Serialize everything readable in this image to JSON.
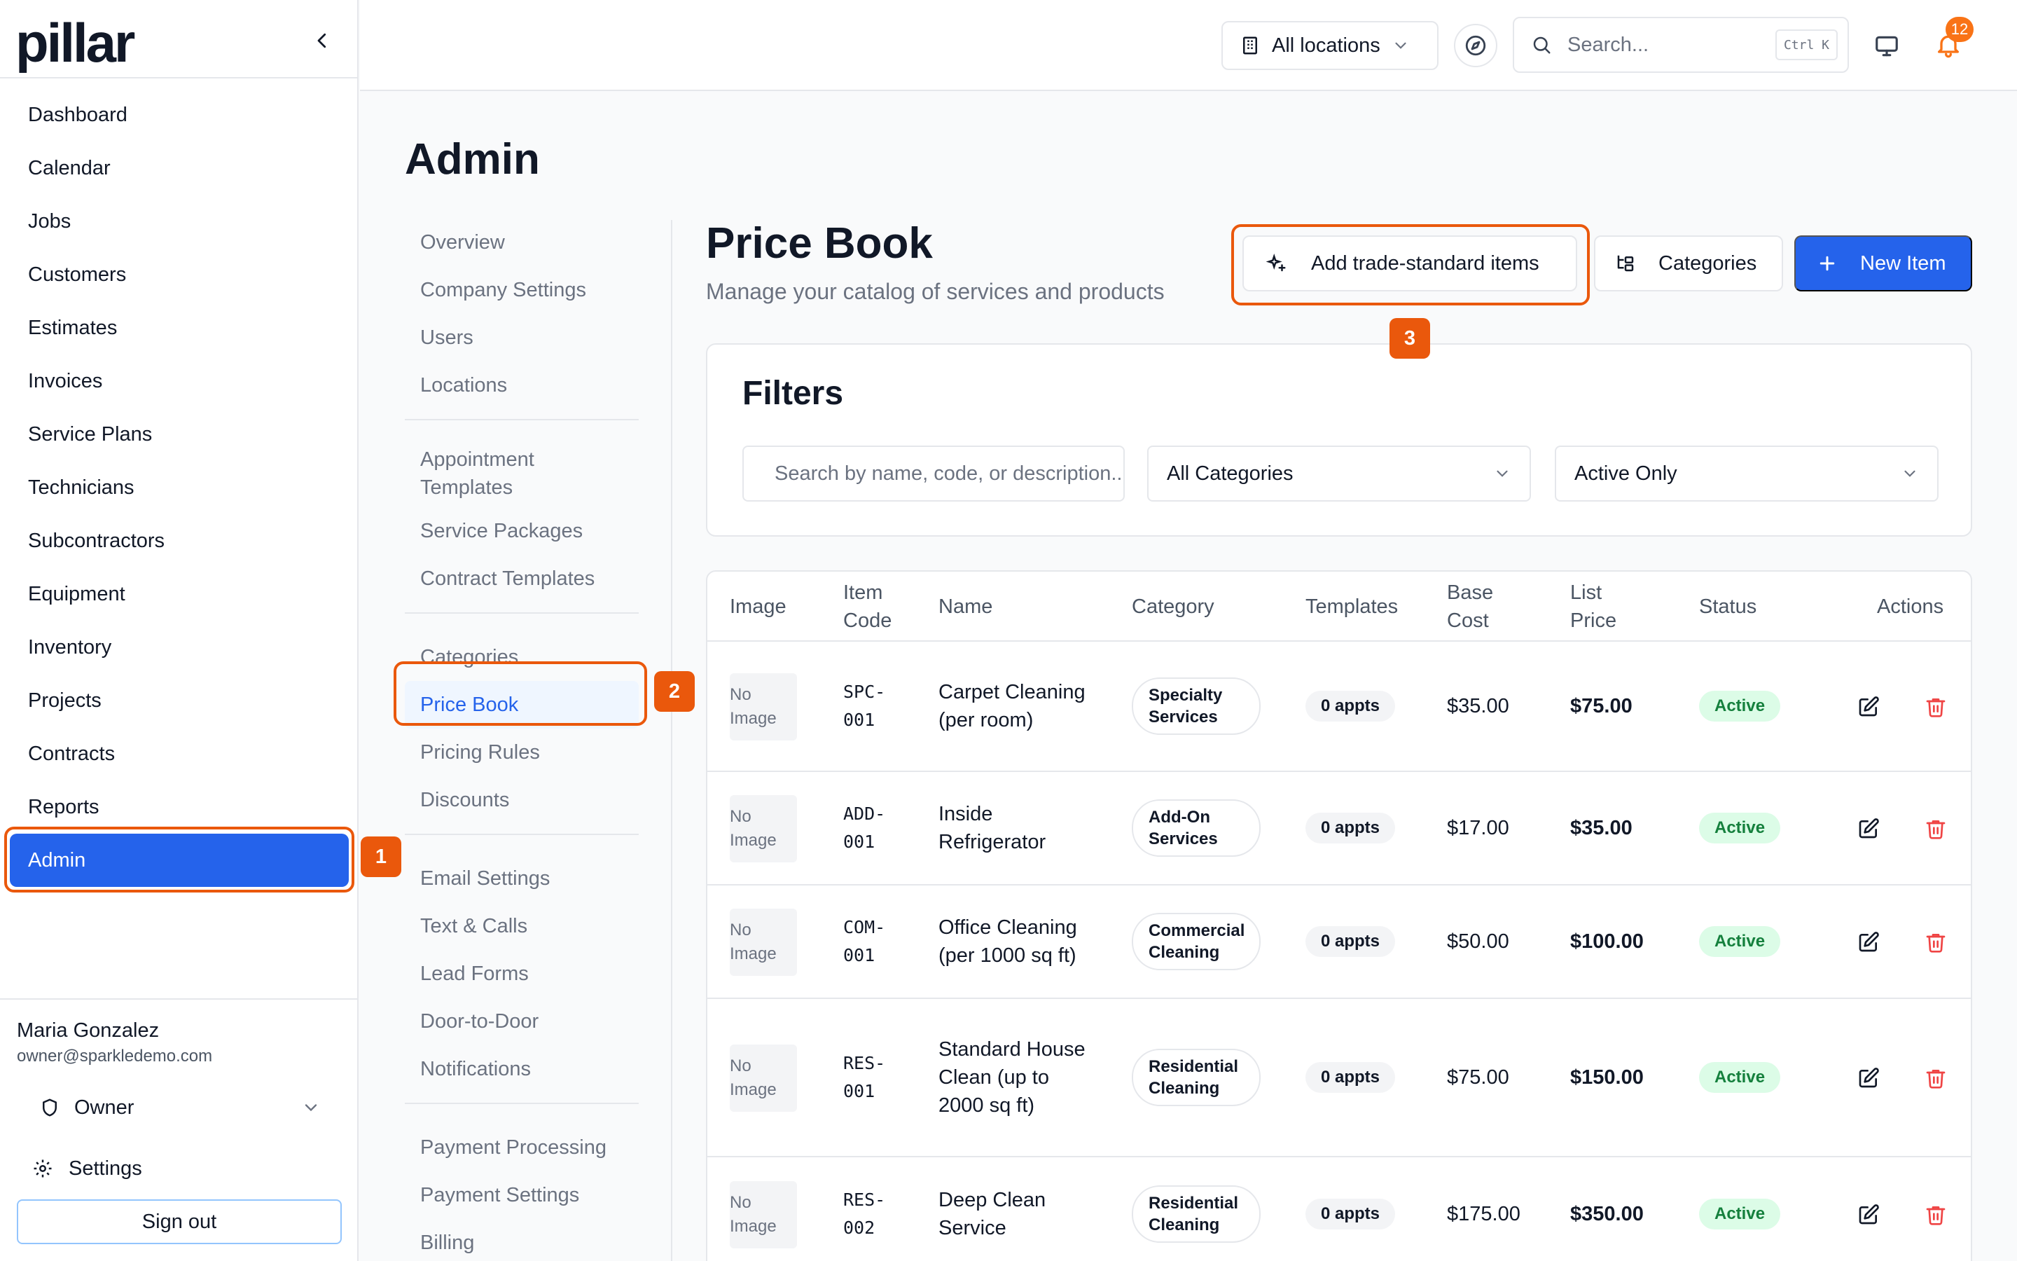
{
  "sidebar": {
    "logo": "pillar",
    "nav": [
      {
        "label": "Dashboard",
        "active": false
      },
      {
        "label": "Calendar",
        "active": false
      },
      {
        "label": "Jobs",
        "active": false
      },
      {
        "label": "Customers",
        "active": false
      },
      {
        "label": "Estimates",
        "active": false
      },
      {
        "label": "Invoices",
        "active": false
      },
      {
        "label": "Service Plans",
        "active": false
      },
      {
        "label": "Technicians",
        "active": false
      },
      {
        "label": "Subcontractors",
        "active": false
      },
      {
        "label": "Equipment",
        "active": false
      },
      {
        "label": "Inventory",
        "active": false
      },
      {
        "label": "Projects",
        "active": false
      },
      {
        "label": "Contracts",
        "active": false
      },
      {
        "label": "Reports",
        "active": false
      },
      {
        "label": "Admin",
        "active": true
      }
    ],
    "user": {
      "name": "Maria Gonzalez",
      "email": "owner@sparkledemo.com",
      "role": "Owner"
    },
    "settings_label": "Settings",
    "signout_label": "Sign out"
  },
  "topbar": {
    "location": "All locations",
    "search_placeholder": "Search...",
    "shortcut": "Ctrl K",
    "notification_count": "12"
  },
  "admin": {
    "title": "Admin",
    "subnav": [
      {
        "label": "Overview"
      },
      {
        "label": "Company Settings"
      },
      {
        "label": "Users"
      },
      {
        "label": "Locations"
      },
      {
        "sep": true
      },
      {
        "label": "Appointment Templates",
        "two_line": true
      },
      {
        "label": "Service Packages"
      },
      {
        "label": "Contract Templates"
      },
      {
        "sep": true
      },
      {
        "label": "Categories"
      },
      {
        "label": "Price Book",
        "active": true
      },
      {
        "label": "Pricing Rules"
      },
      {
        "label": "Discounts"
      },
      {
        "sep": true
      },
      {
        "label": "Email Settings"
      },
      {
        "label": "Text & Calls"
      },
      {
        "label": "Lead Forms"
      },
      {
        "label": "Door-to-Door"
      },
      {
        "label": "Notifications"
      },
      {
        "sep": true
      },
      {
        "label": "Payment Processing"
      },
      {
        "label": "Payment Settings"
      },
      {
        "label": "Billing"
      }
    ]
  },
  "pricebook": {
    "title": "Price Book",
    "subtitle": "Manage your catalog of services and products",
    "btn_trade": "Add trade-standard items",
    "btn_categories": "Categories",
    "btn_new": "New Item",
    "filters": {
      "title": "Filters",
      "search_placeholder": "Search by name, code, or description...",
      "category": "All Categories",
      "status": "Active Only"
    },
    "columns": {
      "image": "Image",
      "item_code": "Item Code",
      "name": "Name",
      "category": "Category",
      "templates": "Templates",
      "base_cost": "Base Cost",
      "list_price": "List Price",
      "status": "Status",
      "actions": "Actions"
    },
    "no_image": "No Image",
    "rows": [
      {
        "code": "SPC-001",
        "name": "Carpet Cleaning (per room)",
        "category": "Specialty Services",
        "templates": "0 appts",
        "base_cost": "$35.00",
        "list_price": "$75.00",
        "status": "Active"
      },
      {
        "code": "ADD-001",
        "name": "Inside Refrigerator",
        "category": "Add-On Services",
        "templates": "0 appts",
        "base_cost": "$17.00",
        "list_price": "$35.00",
        "status": "Active"
      },
      {
        "code": "COM-001",
        "name": "Office Cleaning (per 1000 sq ft)",
        "category": "Commercial Cleaning",
        "templates": "0 appts",
        "base_cost": "$50.00",
        "list_price": "$100.00",
        "status": "Active"
      },
      {
        "code": "RES-001",
        "name": "Standard House Clean (up to 2000 sq ft)",
        "category": "Residential Cleaning",
        "templates": "0 appts",
        "base_cost": "$75.00",
        "list_price": "$150.00",
        "status": "Active"
      },
      {
        "code": "RES-002",
        "name": "Deep Clean Service",
        "category": "Residential Cleaning",
        "templates": "0 appts",
        "base_cost": "$175.00",
        "list_price": "$350.00",
        "status": "Active"
      }
    ]
  },
  "annotations": [
    {
      "label": "1"
    },
    {
      "label": "2"
    },
    {
      "label": "3"
    }
  ],
  "colors": {
    "primary": "#2563eb",
    "annotation": "#ea580c",
    "status_bg": "#dcfce7",
    "status_fg": "#15803d",
    "danger": "#ef4444"
  }
}
